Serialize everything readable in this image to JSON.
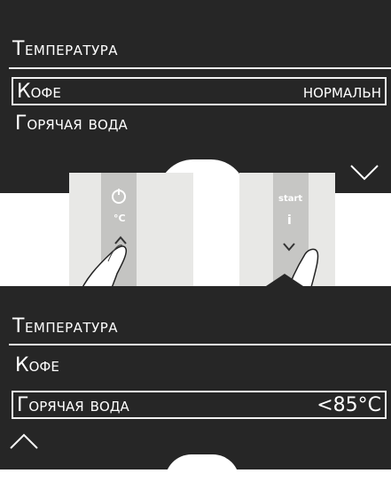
{
  "screens": [
    {
      "title": "Температура",
      "items": [
        {
          "label": "Кофе",
          "value": "нормальн",
          "selected": true
        },
        {
          "label": "Горячая вода",
          "value": "",
          "selected": false
        }
      ],
      "scroll_icon": "chevron-down-icon"
    },
    {
      "title": "Температура",
      "items": [
        {
          "label": "Кофе",
          "value": "",
          "selected": false
        },
        {
          "label": "Горячая вода",
          "value": "<85°C",
          "selected": true
        }
      ],
      "scroll_icon": "chevron-up-icon"
    }
  ],
  "photos": {
    "left": {
      "label_top": "°C",
      "icon_top": "power-icon",
      "button_icon": "chevron-up-icon"
    },
    "right": {
      "label_top": "start",
      "label_mid": "i",
      "button_icon": "chevron-down-icon"
    }
  }
}
